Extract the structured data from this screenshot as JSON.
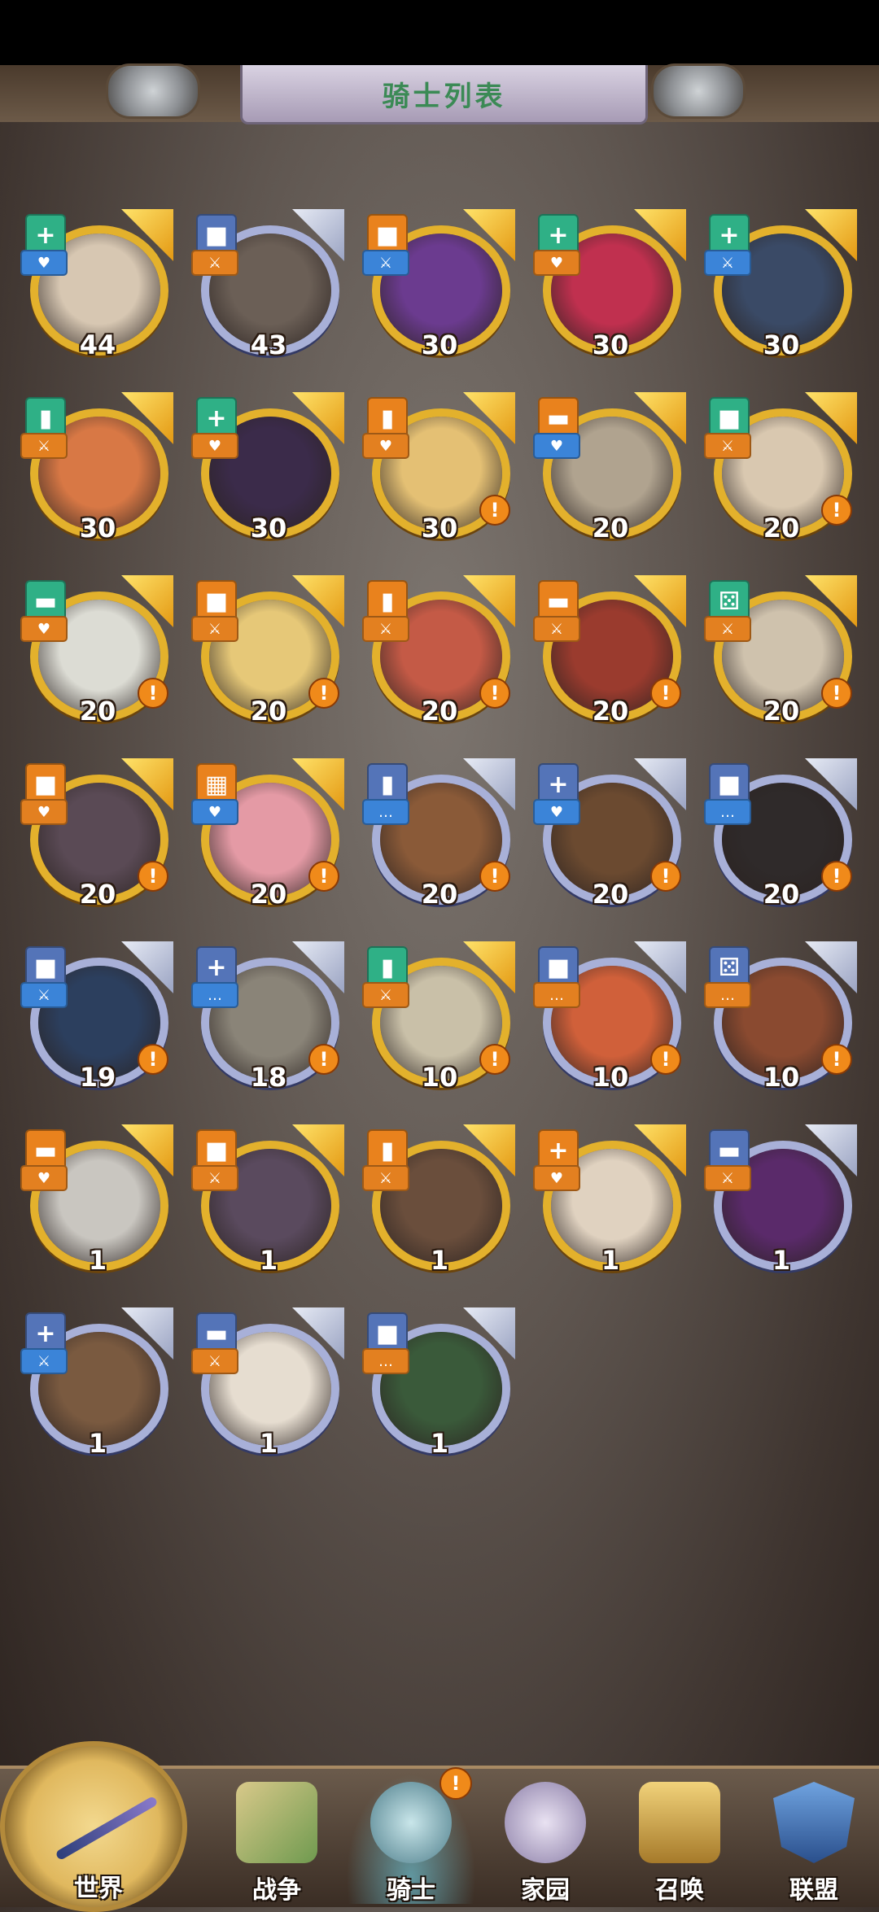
{
  "header": {
    "title": "骑士列表"
  },
  "knights": [
    {
      "level": "44",
      "frame": "gold",
      "cls": "+",
      "cls_color": "green",
      "role": "♥",
      "role_color": "blue",
      "alert": false,
      "face": "#d7c7b2"
    },
    {
      "level": "43",
      "frame": "silver",
      "cls": "■",
      "cls_color": "blue",
      "role": "⚔",
      "role_color": "orange",
      "alert": false,
      "face": "#6b5f56"
    },
    {
      "level": "30",
      "frame": "gold",
      "cls": "■",
      "cls_color": "orange",
      "role": "⚔",
      "role_color": "blue",
      "alert": false,
      "face": "#6b3b8f"
    },
    {
      "level": "30",
      "frame": "gold",
      "cls": "+",
      "cls_color": "green",
      "role": "♥",
      "role_color": "orange",
      "alert": false,
      "face": "#c0304f"
    },
    {
      "level": "30",
      "frame": "gold",
      "cls": "+",
      "cls_color": "green",
      "role": "⚔",
      "role_color": "blue",
      "alert": false,
      "face": "#3a4a66"
    },
    {
      "level": "30",
      "frame": "gold",
      "cls": "▮",
      "cls_color": "green",
      "role": "⚔",
      "role_color": "orange",
      "alert": false,
      "face": "#d87845"
    },
    {
      "level": "30",
      "frame": "gold",
      "cls": "+",
      "cls_color": "green",
      "role": "♥",
      "role_color": "orange",
      "alert": false,
      "face": "#3b2b4a"
    },
    {
      "level": "30",
      "frame": "gold",
      "cls": "▮",
      "cls_color": "orange",
      "role": "♥",
      "role_color": "orange",
      "alert": true,
      "face": "#e4c074"
    },
    {
      "level": "20",
      "frame": "gold",
      "cls": "▬",
      "cls_color": "orange",
      "role": "♥",
      "role_color": "blue",
      "alert": false,
      "face": "#b0a38f"
    },
    {
      "level": "20",
      "frame": "gold",
      "cls": "■",
      "cls_color": "green",
      "role": "⚔",
      "role_color": "orange",
      "alert": true,
      "face": "#d9c8b0"
    },
    {
      "level": "20",
      "frame": "gold",
      "cls": "▬",
      "cls_color": "green",
      "role": "♥",
      "role_color": "orange",
      "alert": true,
      "face": "#dcdcd4"
    },
    {
      "level": "20",
      "frame": "gold",
      "cls": "■",
      "cls_color": "orange",
      "role": "⚔",
      "role_color": "orange",
      "alert": true,
      "face": "#e6c878"
    },
    {
      "level": "20",
      "frame": "gold",
      "cls": "▮",
      "cls_color": "orange",
      "role": "⚔",
      "role_color": "orange",
      "alert": true,
      "face": "#c45a46"
    },
    {
      "level": "20",
      "frame": "gold",
      "cls": "▬",
      "cls_color": "orange",
      "role": "⚔",
      "role_color": "orange",
      "alert": true,
      "face": "#9a3b2e"
    },
    {
      "level": "20",
      "frame": "gold",
      "cls": "⚄",
      "cls_color": "green",
      "role": "⚔",
      "role_color": "orange",
      "alert": true,
      "face": "#cfc2ad"
    },
    {
      "level": "20",
      "frame": "gold",
      "cls": "■",
      "cls_color": "orange",
      "role": "♥",
      "role_color": "orange",
      "alert": true,
      "face": "#5a4a55"
    },
    {
      "level": "20",
      "frame": "gold",
      "cls": "▦",
      "cls_color": "orange",
      "role": "♥",
      "role_color": "blue",
      "alert": true,
      "face": "#e49aa5"
    },
    {
      "level": "20",
      "frame": "silver",
      "cls": "▮",
      "cls_color": "blue",
      "role": "…",
      "role_color": "blue",
      "alert": true,
      "face": "#8a5a38"
    },
    {
      "level": "20",
      "frame": "silver",
      "cls": "+",
      "cls_color": "blue",
      "role": "♥",
      "role_color": "blue",
      "alert": true,
      "face": "#6b4a30"
    },
    {
      "level": "20",
      "frame": "silver",
      "cls": "■",
      "cls_color": "blue",
      "role": "…",
      "role_color": "blue",
      "alert": true,
      "face": "#2f2a2a"
    },
    {
      "level": "19",
      "frame": "silver",
      "cls": "■",
      "cls_color": "blue",
      "role": "⚔",
      "role_color": "blue",
      "alert": true,
      "face": "#2c3f5e"
    },
    {
      "level": "18",
      "frame": "silver",
      "cls": "+",
      "cls_color": "blue",
      "role": "…",
      "role_color": "blue",
      "alert": true,
      "face": "#8a8478"
    },
    {
      "level": "10",
      "frame": "gold",
      "cls": "▮",
      "cls_color": "green",
      "role": "⚔",
      "role_color": "orange",
      "alert": true,
      "face": "#c9c0a8"
    },
    {
      "level": "10",
      "frame": "silver",
      "cls": "■",
      "cls_color": "blue",
      "role": "…",
      "role_color": "orange",
      "alert": true,
      "face": "#d0603a"
    },
    {
      "level": "10",
      "frame": "silver",
      "cls": "⚄",
      "cls_color": "blue",
      "role": "…",
      "role_color": "orange",
      "alert": true,
      "face": "#8a4a30"
    },
    {
      "level": "1",
      "frame": "gold",
      "cls": "▬",
      "cls_color": "orange",
      "role": "♥",
      "role_color": "orange",
      "alert": false,
      "face": "#c9c6c0"
    },
    {
      "level": "1",
      "frame": "gold",
      "cls": "■",
      "cls_color": "orange",
      "role": "⚔",
      "role_color": "orange",
      "alert": false,
      "face": "#5a4a5e"
    },
    {
      "level": "1",
      "frame": "gold",
      "cls": "▮",
      "cls_color": "orange",
      "role": "⚔",
      "role_color": "orange",
      "alert": false,
      "face": "#6a4e3c"
    },
    {
      "level": "1",
      "frame": "gold",
      "cls": "+",
      "cls_color": "orange",
      "role": "♥",
      "role_color": "orange",
      "alert": false,
      "face": "#e0d2c0"
    },
    {
      "level": "1",
      "frame": "silver",
      "cls": "▬",
      "cls_color": "blue",
      "role": "⚔",
      "role_color": "orange",
      "alert": false,
      "face": "#5a2a6a"
    },
    {
      "level": "1",
      "frame": "silver",
      "cls": "+",
      "cls_color": "blue",
      "role": "⚔",
      "role_color": "blue",
      "alert": false,
      "face": "#7a5a40"
    },
    {
      "level": "1",
      "frame": "silver",
      "cls": "▬",
      "cls_color": "blue",
      "role": "⚔",
      "role_color": "orange",
      "alert": false,
      "face": "#e6ddd0"
    },
    {
      "level": "1",
      "frame": "silver",
      "cls": "■",
      "cls_color": "blue",
      "role": "…",
      "role_color": "orange",
      "alert": false,
      "face": "#3a5a3a"
    }
  ],
  "nav": {
    "world": "世界",
    "war": "战争",
    "knight": "骑士",
    "home": "家园",
    "summon": "召唤",
    "alliance": "联盟",
    "knight_alert": "!"
  },
  "colors": {
    "gold_frame": "#e3b12c",
    "silver_frame": "#a8b0d8",
    "alert": "#f08a1a"
  }
}
